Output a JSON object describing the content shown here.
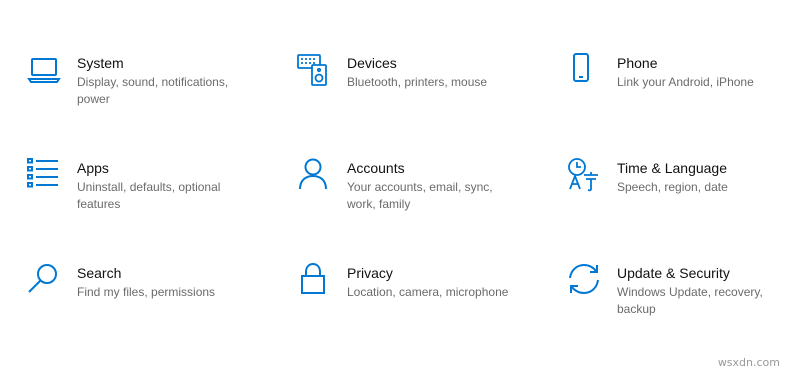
{
  "accent_color": "#0078d4",
  "tiles": [
    {
      "title": "System",
      "desc": "Display, sound, notifications, power",
      "icon": "laptop-icon"
    },
    {
      "title": "Devices",
      "desc": "Bluetooth, printers, mouse",
      "icon": "keyboard-speaker-icon"
    },
    {
      "title": "Phone",
      "desc": "Link your Android, iPhone",
      "icon": "phone-icon"
    },
    {
      "title": "Apps",
      "desc": "Uninstall, defaults, optional features",
      "icon": "apps-list-icon"
    },
    {
      "title": "Accounts",
      "desc": "Your accounts, email, sync, work, family",
      "icon": "person-icon"
    },
    {
      "title": "Time & Language",
      "desc": "Speech, region, date",
      "icon": "time-language-icon"
    },
    {
      "title": "Search",
      "desc": "Find my files, permissions",
      "icon": "search-icon"
    },
    {
      "title": "Privacy",
      "desc": "Location, camera, microphone",
      "icon": "lock-icon"
    },
    {
      "title": "Update & Security",
      "desc": "Windows Update, recovery, backup",
      "icon": "sync-arrows-icon"
    }
  ],
  "watermark": "wsxdn.com"
}
